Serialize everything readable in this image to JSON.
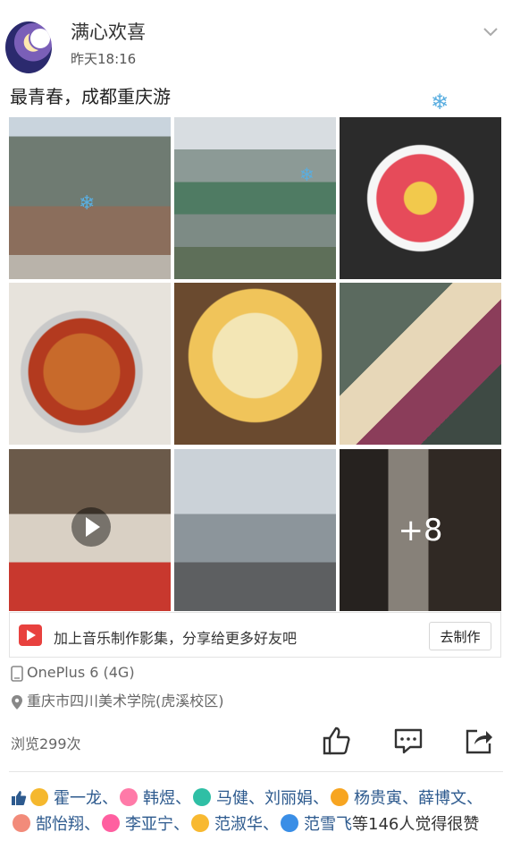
{
  "post": {
    "username": "满心欢喜",
    "timestamp": "昨天18:16",
    "title": "最青春，成都重庆游",
    "more_photos": "+8"
  },
  "music": {
    "text": "加上音乐制作影集，分享给更多好友吧",
    "button": "去制作"
  },
  "meta": {
    "device": "OnePlus 6 (4G)",
    "location": "重庆市四川美术学院(虎溪校区)",
    "views": "浏览299次"
  },
  "likes": {
    "names": [
      "霍一龙",
      "韩煜",
      "马健",
      "刘丽娟",
      "杨贵寅",
      "薛博文",
      "郜怡翔",
      "李亚宁",
      "范淑华",
      "范雪飞"
    ],
    "tail": "等146人觉得很赞",
    "separator": "、"
  },
  "colors": {
    "link": "#2d5a8e",
    "accent_red": "#e8413e",
    "snowflake": "#5aaee0"
  },
  "icons": [
    "chevron-down-icon",
    "play-icon",
    "device-icon",
    "location-icon",
    "thumb-up-icon",
    "comment-icon",
    "share-icon",
    "snowflake-icon"
  ]
}
